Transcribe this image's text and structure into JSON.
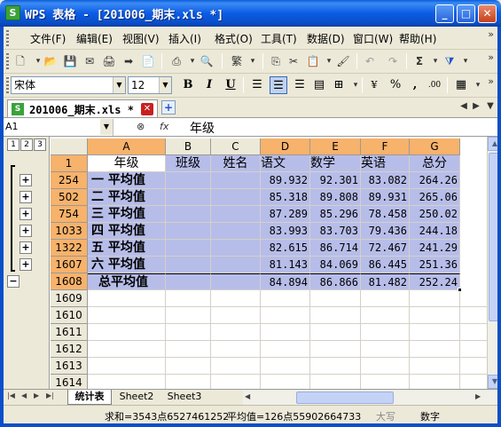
{
  "window": {
    "app_icon": "S",
    "title": "WPS 表格 - [201006_期末.xls *]",
    "minimize": "_",
    "maximize": "□",
    "close": "✕"
  },
  "menu": [
    "文件(F)",
    "编辑(E)",
    "视图(V)",
    "插入(I)",
    "格式(O)",
    "工具(T)",
    "数据(D)",
    "窗口(W)",
    "帮助(H)"
  ],
  "format_toolbar": {
    "font_name": "宋体",
    "font_size": "12",
    "bold": "B",
    "italic": "I",
    "underline": "U",
    "percent": "%",
    "comma": ","
  },
  "doc_tab": {
    "icon": "S",
    "filename": "201006_期末.xls *",
    "close": "✕",
    "new_tab": "+"
  },
  "formula_bar": {
    "cell_ref": "A1",
    "fx": "fx",
    "content": "年级"
  },
  "outline_levels": [
    "1",
    "2",
    "3"
  ],
  "columns": [
    "A",
    "B",
    "C",
    "D",
    "E",
    "F",
    "G"
  ],
  "header_row": {
    "row_num": "1",
    "cells": [
      "年级",
      "班级",
      "姓名",
      "语文",
      "数学",
      "英语",
      "总分"
    ]
  },
  "data_rows": [
    {
      "row_num": "254",
      "label": "一 平均值",
      "yuwen": "89.932",
      "shuxue": "92.301",
      "yingyu": "83.082",
      "zongfen": "264.26"
    },
    {
      "row_num": "502",
      "label": "二 平均值",
      "yuwen": "85.318",
      "shuxue": "89.808",
      "yingyu": "89.931",
      "zongfen": "265.06"
    },
    {
      "row_num": "754",
      "label": "三 平均值",
      "yuwen": "87.289",
      "shuxue": "85.296",
      "yingyu": "78.458",
      "zongfen": "250.02"
    },
    {
      "row_num": "1033",
      "label": "四 平均值",
      "yuwen": "83.993",
      "shuxue": "83.703",
      "yingyu": "79.436",
      "zongfen": "244.18"
    },
    {
      "row_num": "1322",
      "label": "五 平均值",
      "yuwen": "82.615",
      "shuxue": "86.714",
      "yingyu": "72.467",
      "zongfen": "241.29"
    },
    {
      "row_num": "1607",
      "label": "六 平均值",
      "yuwen": "81.143",
      "shuxue": "84.069",
      "yingyu": "86.445",
      "zongfen": "251.36"
    },
    {
      "row_num": "1608",
      "label": "总平均值",
      "yuwen": "84.894",
      "shuxue": "86.866",
      "yingyu": "81.482",
      "zongfen": "252.24"
    }
  ],
  "empty_rows": [
    "1609",
    "1610",
    "1611",
    "1612",
    "1613",
    "1614"
  ],
  "sheet_tabs": [
    "统计表",
    "Sheet2",
    "Sheet3"
  ],
  "status": {
    "sum": "求和=3543点6527461252",
    "avg": "平均值=126点55902664733",
    "caps": "大写",
    "numlock": "数字"
  }
}
